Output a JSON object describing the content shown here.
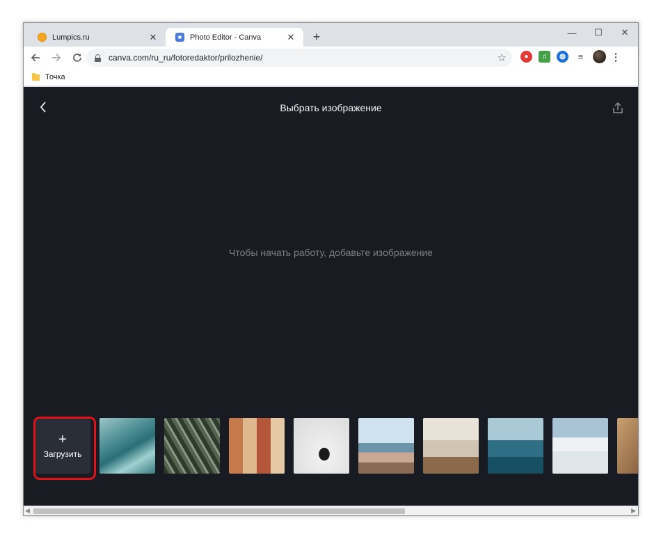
{
  "browser": {
    "tabs": [
      {
        "title": "Lumpics.ru",
        "favicon": "lumpics-orange-icon",
        "active": false
      },
      {
        "title": "Photo Editor - Canva",
        "favicon": "canva-icon",
        "active": true
      }
    ],
    "new_tab": "+",
    "window_controls": {
      "minimize": "—",
      "maximize": "☐",
      "close": "✕"
    },
    "address": "canva.com/ru_ru/fotoredaktor/prilozhenie/",
    "bookmarks": [
      {
        "label": "Точка",
        "icon": "folder-icon"
      }
    ],
    "extensions": [
      "ublock-icon",
      "music-icon",
      "globe-icon",
      "queue-icon",
      "profile-avatar",
      "menu-icon"
    ]
  },
  "page": {
    "title": "Выбрать изображение",
    "empty_message": "Чтобы начать работу, добавьте изображение",
    "upload": {
      "plus": "+",
      "label": "Загрузить"
    },
    "thumbnails": [
      "ocean-waves",
      "palm-leaves",
      "building-facade",
      "coffee-cup",
      "woman-on-beach",
      "interior-room",
      "surfer-wave",
      "foggy-city",
      "desert"
    ],
    "highlight_color": "#e0131b",
    "background_color": "#181b22"
  }
}
